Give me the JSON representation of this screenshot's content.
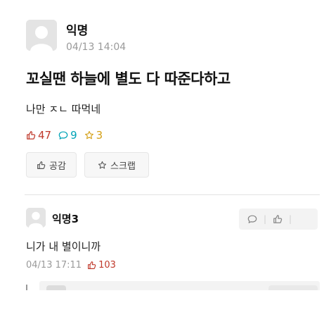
{
  "post": {
    "author": "익명",
    "timestamp": "04/13 14:04",
    "title": "꼬실땐 하늘에 별도 다 따준다하고",
    "body": "나만 ㅈㄴ 따먹네",
    "stats": {
      "likes": "47",
      "comments": "9",
      "scraps": "3"
    },
    "buttons": {
      "like": "공감",
      "scrap": "스크랩"
    }
  },
  "comment": {
    "author": "익명3",
    "body": "니가 내 별이니까",
    "timestamp": "04/13 17:11",
    "likes": "103"
  },
  "icons": {
    "like": "thumbs-up-icon",
    "comment": "speech-bubble-icon",
    "scrap": "star-icon",
    "avatar": "default-avatar-icon"
  },
  "colors": {
    "like": "#c0392b",
    "comment": "#00a3b6",
    "scrap": "#d4a017",
    "muted": "#9a9a9a"
  }
}
